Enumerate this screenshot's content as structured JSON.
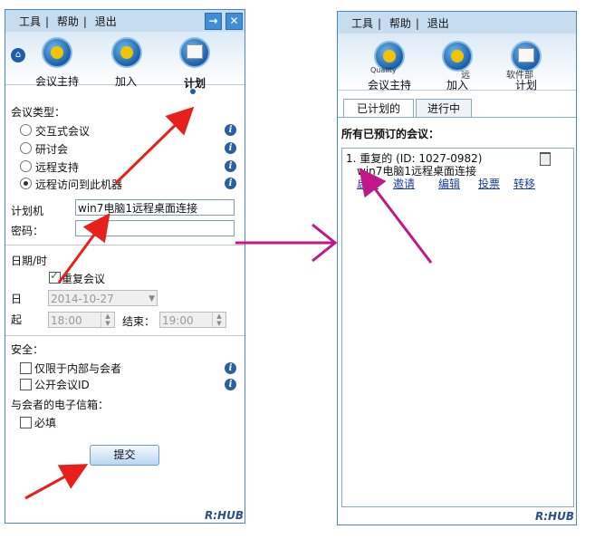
{
  "left": {
    "menu": {
      "tools": "工具",
      "help": "帮助",
      "exit": "退出"
    },
    "nav": {
      "host": "会议主持",
      "join": "加入",
      "schedule": "计划"
    },
    "meeting_type_label": "会议类型：",
    "types": [
      {
        "label": "交互式会议",
        "selected": false
      },
      {
        "label": "研讨会",
        "selected": false
      },
      {
        "label": "远程支持",
        "selected": false
      },
      {
        "label": "远程访问到此机器",
        "selected": true
      }
    ],
    "computer_label": "计划机",
    "computer_value": "win7电脑1远程桌面连接",
    "password_label": "密码：",
    "date_section": "日期/时",
    "repeat_label": "重复会议",
    "repeat_checked": true,
    "day_label": "日",
    "day_value": "2014-10-27",
    "start_label": "起",
    "start_value": "18:00",
    "end_label": "结束：",
    "end_value": "19:00",
    "security_label": "安全：",
    "internal_only": "仅限于内部与会者",
    "public_id": "公开会议ID",
    "email_label": "与会者的电子信箱：",
    "required": "必填",
    "submit": "提交",
    "logo": "R:HUB"
  },
  "right": {
    "menu": {
      "tools": "工具",
      "help": "帮助",
      "exit": "退出"
    },
    "nav_overlap": "Quality",
    "nav_overlap2": "远",
    "nav_overlap3": "软件部",
    "nav": {
      "host": "会议主持",
      "join": "加入",
      "schedule": "计划"
    },
    "tabs": {
      "planned": "已计划的",
      "ongoing": "进行中"
    },
    "heading": "所有已预订的会议：",
    "meeting": {
      "title": "1. 重复的 (ID: 1027-0982)",
      "name": "win7电脑1远程桌面连接",
      "actions": [
        "启动",
        "邀请",
        "编辑",
        "投票",
        "转移"
      ]
    },
    "logo": "R:HUB"
  },
  "colors": {
    "arrow_red": "#e8201c",
    "arrow_magenta": "#c0188a",
    "frame_blue": "#4a86c8",
    "toolbar_blue": "#c6ddf0"
  }
}
